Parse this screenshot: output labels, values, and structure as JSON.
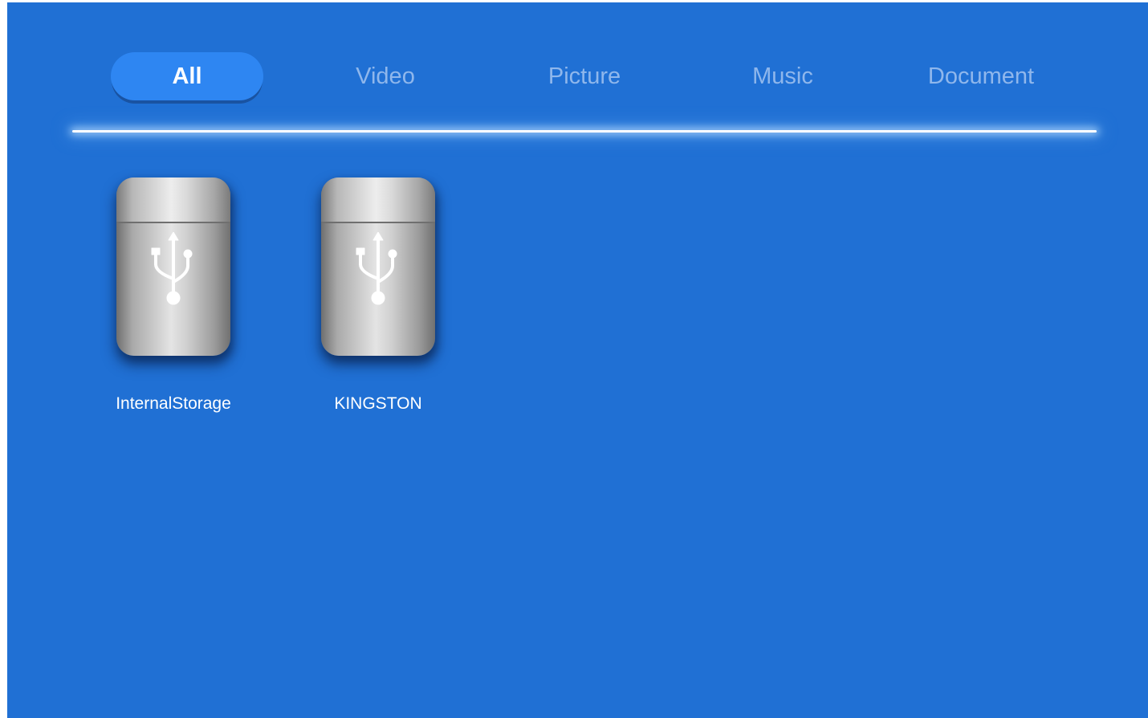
{
  "tabs": [
    {
      "label": "All",
      "active": true
    },
    {
      "label": "Video",
      "active": false
    },
    {
      "label": "Picture",
      "active": false
    },
    {
      "label": "Music",
      "active": false
    },
    {
      "label": "Document",
      "active": false
    }
  ],
  "drives": [
    {
      "label": "InternalStorage",
      "icon": "usb-drive-icon"
    },
    {
      "label": "KINGSTON",
      "icon": "usb-drive-icon"
    }
  ],
  "colors": {
    "background": "#2070d4",
    "active_tab": "#2e86f2",
    "inactive_tab_text": "#8fb7ec",
    "text": "#ffffff"
  }
}
